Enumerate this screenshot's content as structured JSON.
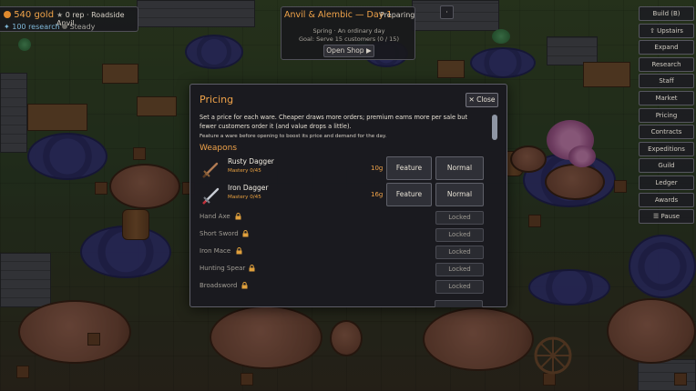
{
  "hud": {
    "gold": "540 gold",
    "reputation": "0 rep · Roadside Anvil",
    "research": "100 research",
    "status": "Steady"
  },
  "day_panel": {
    "title": "Anvil & Alembic — Day 1",
    "phase": "Preparing",
    "season": "Spring · An ordinary day",
    "goal": "Goal: Serve 15 customers (0 / 15)",
    "open_shop_label": "Open Shop ▶",
    "goal_progress": {
      "current": 0,
      "target": 15
    }
  },
  "menu_dot": "·",
  "sidebar": {
    "items": [
      {
        "label": "Build (B)"
      },
      {
        "label": "⇧ Upstairs"
      },
      {
        "label": "Expand"
      },
      {
        "label": "Research"
      },
      {
        "label": "Staff"
      },
      {
        "label": "Market"
      },
      {
        "label": "Pricing"
      },
      {
        "label": "Contracts"
      },
      {
        "label": "Expeditions"
      },
      {
        "label": "Guild"
      },
      {
        "label": "Ledger"
      },
      {
        "label": "Awards"
      },
      {
        "label": "☰ Pause"
      }
    ]
  },
  "pricing": {
    "title": "Pricing",
    "close_label": "✕ Close",
    "description": "Set a price for each ware. Cheaper draws more orders; premium earns more per sale but fewer customers order it (and value drops a little).",
    "hint": "Feature a ware before opening to boost its price and demand for the day.",
    "section": "Weapons",
    "items": [
      {
        "name": "Rusty Dagger",
        "mastery": "Mastery 0/45",
        "price": "10g",
        "feature_label": "Feature",
        "tier_label": "Normal",
        "icon": "rusty-dagger-icon"
      },
      {
        "name": "Iron Dagger",
        "mastery": "Mastery 0/45",
        "price": "16g",
        "feature_label": "Feature",
        "tier_label": "Normal",
        "icon": "iron-dagger-icon"
      }
    ],
    "locked_items": [
      {
        "name": "Hand Axe",
        "status": "Locked"
      },
      {
        "name": "Short Sword",
        "status": "Locked"
      },
      {
        "name": "Iron Mace",
        "status": "Locked"
      },
      {
        "name": "Hunting Spear",
        "status": "Locked"
      },
      {
        "name": "Broadsword",
        "status": "Locked"
      }
    ]
  },
  "colors": {
    "accent": "#f0a34a",
    "panel": "#1a1a20",
    "research": "#7fb8d8"
  }
}
